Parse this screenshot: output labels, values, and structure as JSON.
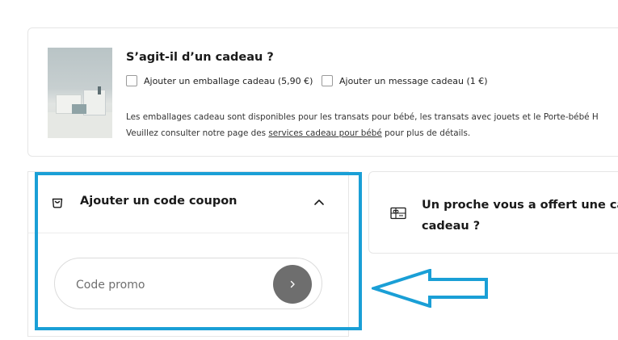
{
  "gift_section": {
    "title": "S’agit-il d’un cadeau ?",
    "options": [
      {
        "label": "Ajouter un emballage cadeau (5,90 €)",
        "checked": false
      },
      {
        "label": "Ajouter un message cadeau (1 €)",
        "checked": false
      }
    ],
    "description_line1": "Les emballages cadeau sont disponibles pour les transats pour bébé, les transats avec jouets et le Porte-bébé H",
    "description_line2_prefix": "Veuillez consulter notre page des ",
    "description_link": "services cadeau pour bébé",
    "description_line2_suffix": " pour plus de détails."
  },
  "coupon": {
    "title": "Ajouter un code coupon",
    "icon": "shopping-bag-icon",
    "expanded": true,
    "input_placeholder": "Code promo",
    "input_value": ""
  },
  "gift_card": {
    "title_line1": "Un proche vous a offert une cart",
    "title_line2": "cadeau ?",
    "icon": "gift-card-icon"
  },
  "annotation": {
    "highlight_color": "#1a9fd6",
    "arrow_color": "#1a9fd6"
  }
}
